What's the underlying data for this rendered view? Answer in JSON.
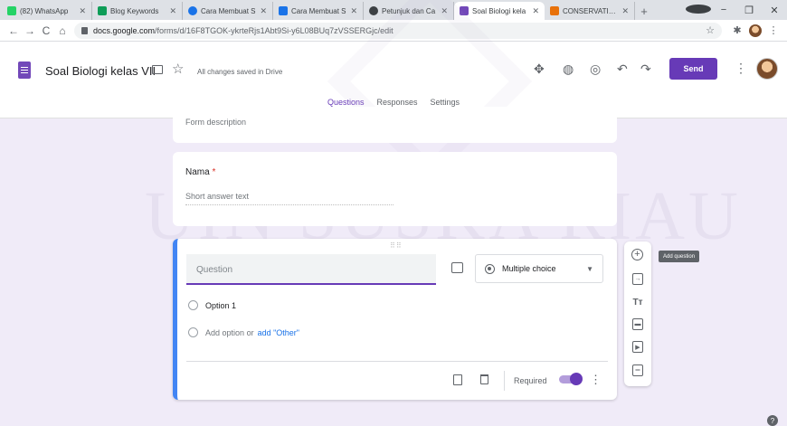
{
  "browser": {
    "tabs": [
      {
        "label": "(82) WhatsApp",
        "color": "#25d366",
        "glyph": "●"
      },
      {
        "label": "Blog Keywords",
        "color": "#0f9d58",
        "glyph": "▦"
      },
      {
        "label": "Cara Membuat S",
        "color": "#1a73e8",
        "glyph": "◆"
      },
      {
        "label": "Cara Membuat S",
        "color": "#1a73e8",
        "glyph": "▮"
      },
      {
        "label": "Petunjuk dan Ca",
        "color": "#3c4043",
        "glyph": "◉"
      },
      {
        "label": "Soal Biologi kela",
        "color": "#7248b9",
        "glyph": "≡"
      },
      {
        "label": "CONSERVATION",
        "color": "#e8710a",
        "glyph": "✿"
      }
    ],
    "url_host": "docs.google.com",
    "url_path": "/forms/d/16F8TGOK-ykrteRjs1Abt9Si-y6L08BUq7zVSSERGjc/edit"
  },
  "forms_header": {
    "title": "Soal Biologi kelas VII",
    "saved_status": "All changes saved in Drive",
    "send_label": "Send",
    "tabs": [
      {
        "label": "Questions",
        "active": true
      },
      {
        "label": "Responses",
        "active": false
      },
      {
        "label": "Settings",
        "active": false
      }
    ]
  },
  "form": {
    "description_placeholder": "Form description",
    "questions": [
      {
        "title": "Nama",
        "required_mark": "*",
        "answer_placeholder": "Short answer text"
      }
    ],
    "active_question": {
      "placeholder": "Question",
      "type": "Multiple choice",
      "option1": "Option 1",
      "add_option": "Add option",
      "or": "or",
      "add_other": "add \"Other\"",
      "required_label": "Required",
      "required_on": true
    }
  },
  "side_toolbar": {
    "tooltip": "Add question",
    "items": [
      "add-question-icon",
      "import-questions-icon",
      "add-title-icon",
      "add-image-icon",
      "add-video-icon",
      "add-section-icon"
    ]
  },
  "watermark": "UIN SUSKA RIAU",
  "colors": {
    "accent": "#673ab7",
    "focus_border": "#4285f4",
    "background": "#f0ebf8"
  }
}
